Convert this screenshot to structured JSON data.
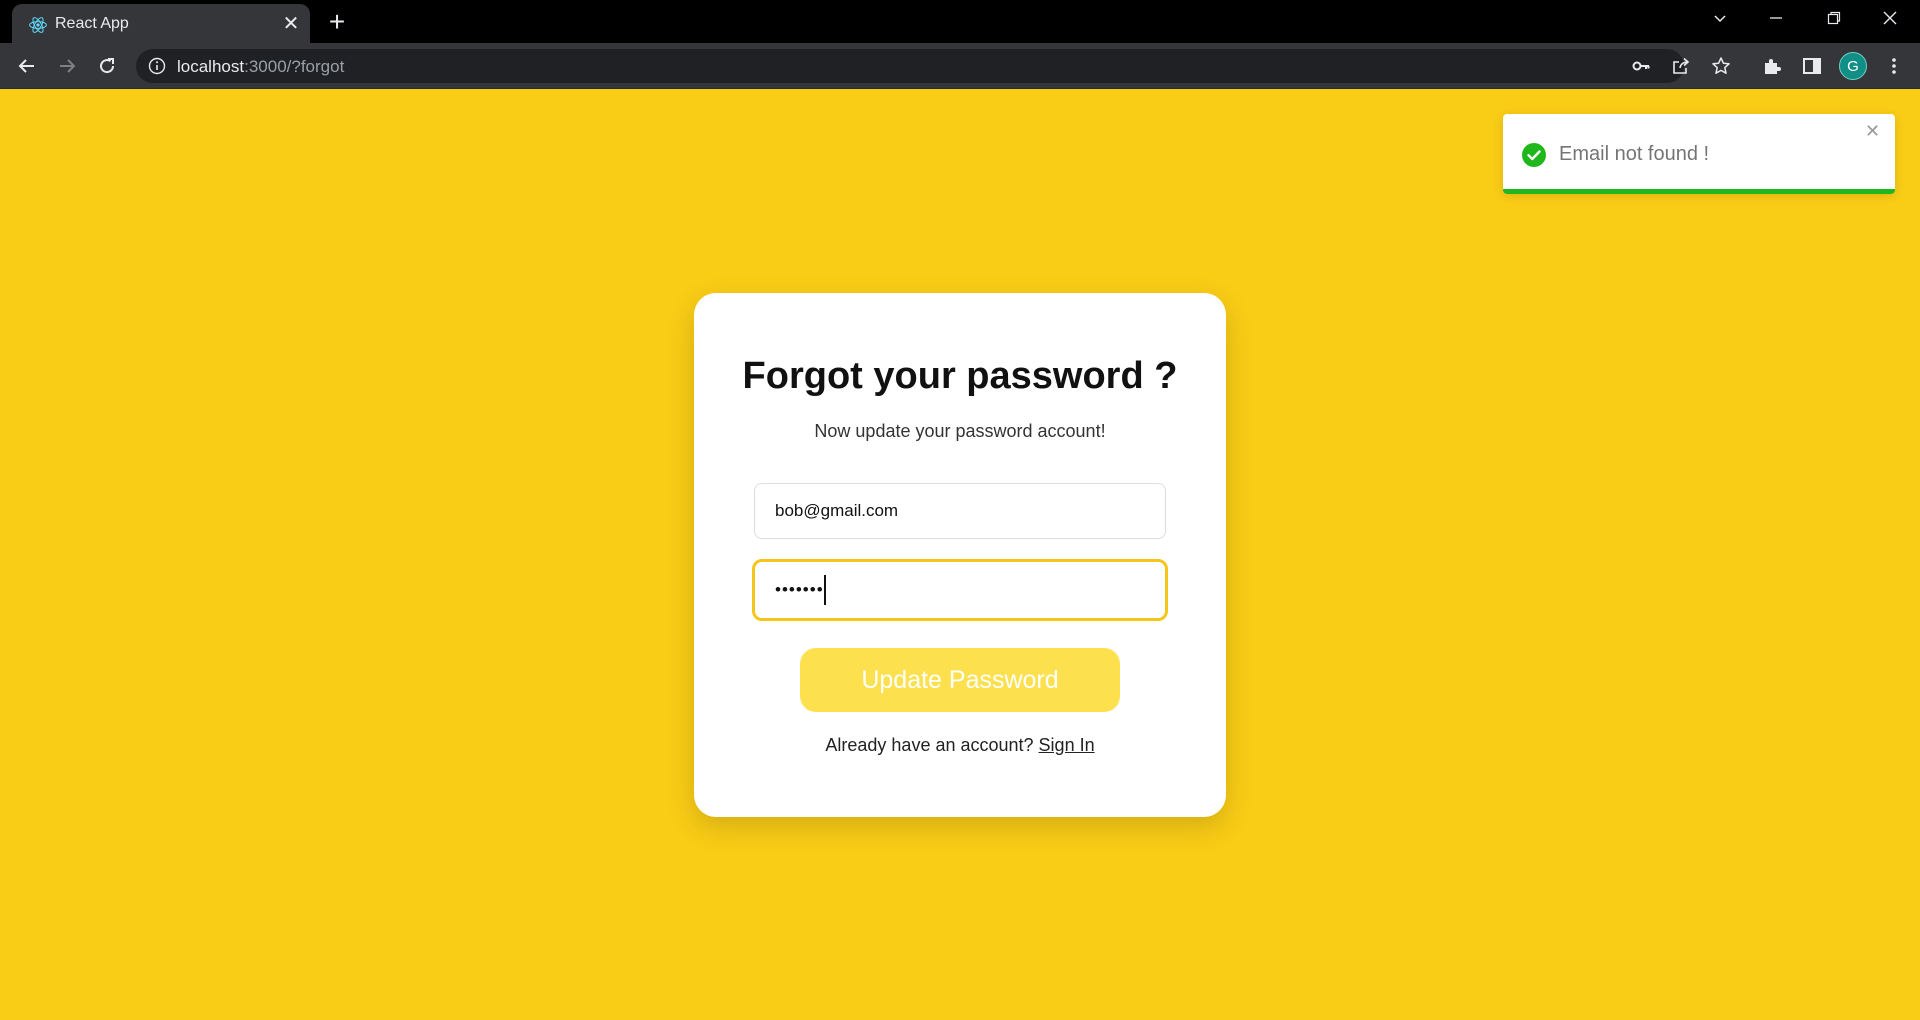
{
  "browser": {
    "tab_title": "React App",
    "url_host": "localhost",
    "url_rest": ":3000/?forgot",
    "profile_initial": "G"
  },
  "form": {
    "title": "Forgot your password ?",
    "subtitle": "Now update your password account!",
    "email_value": "bob@gmail.com",
    "password_value": "•••••••",
    "submit_label": "Update Password",
    "signin_prompt": "Already have an account? ",
    "signin_link": "Sign In"
  },
  "toast": {
    "message": "Email not found !",
    "progress": 1.0
  },
  "colors": {
    "page_bg": "#f9cc16",
    "button_bg": "#fde04e",
    "toast_success": "#20b71c"
  }
}
